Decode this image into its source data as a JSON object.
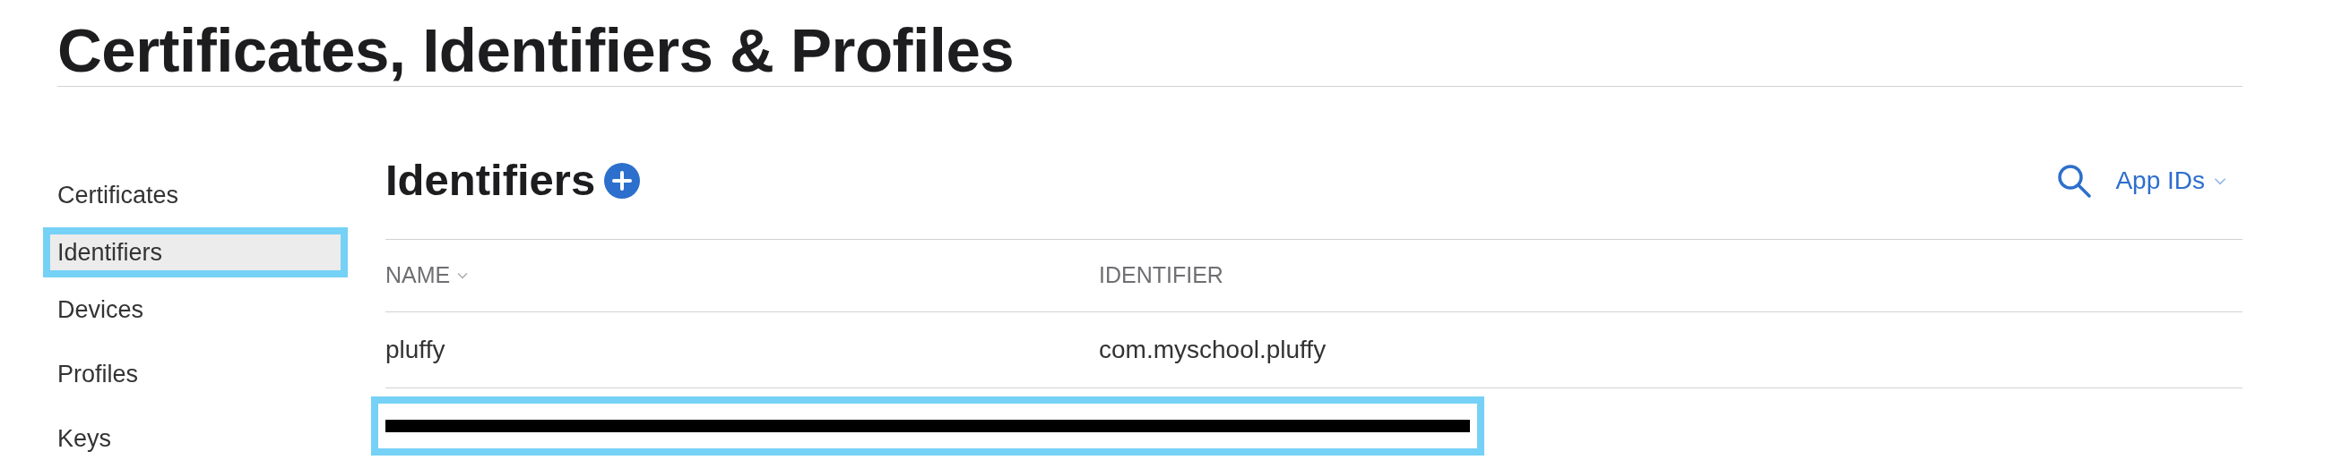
{
  "page_title": "Certificates, Identifiers & Profiles",
  "sidebar": {
    "items": [
      {
        "label": "Certificates",
        "selected": false,
        "highlighted": false
      },
      {
        "label": "Identifiers",
        "selected": true,
        "highlighted": true
      },
      {
        "label": "Devices",
        "selected": false,
        "highlighted": false
      },
      {
        "label": "Profiles",
        "selected": false,
        "highlighted": false
      },
      {
        "label": "Keys",
        "selected": false,
        "highlighted": false
      }
    ]
  },
  "section": {
    "title": "Identifiers",
    "filter": "App IDs"
  },
  "table": {
    "columns": [
      {
        "label": "NAME",
        "sorted": true
      },
      {
        "label": "IDENTIFIER",
        "sorted": false
      }
    ],
    "rows": [
      {
        "name": "pluffy",
        "identifier": "com.myschool.pluffy",
        "redacted": false,
        "highlighted": false
      },
      {
        "redacted": true,
        "highlighted": true
      }
    ]
  }
}
